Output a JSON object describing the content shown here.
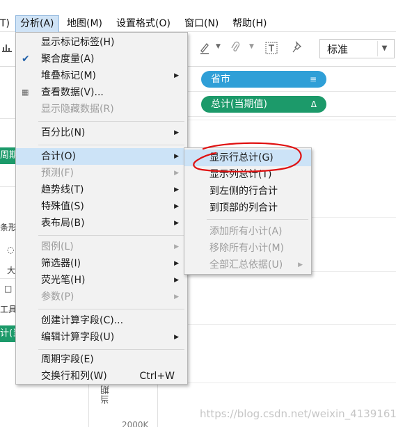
{
  "menubar": {
    "items": [
      {
        "label": "T)"
      },
      {
        "label": "分析(A)"
      },
      {
        "label": "地图(M)"
      },
      {
        "label": "设置格式(O)"
      },
      {
        "label": "窗口(N)"
      },
      {
        "label": "帮助(H)"
      }
    ]
  },
  "toolbar": {
    "standard_select": "标准"
  },
  "shelves": {
    "rows_pill": {
      "label": "省市",
      "icon": "≡",
      "color": "#2f9fd7"
    },
    "measure_pill": {
      "label": "总计(当期值)",
      "icon": "Δ",
      "color": "#1c9a6a"
    }
  },
  "left_strip": {
    "green1": "周期",
    "text1": "条形图",
    "text2": "大",
    "text3": "工具",
    "green2": "计(当"
  },
  "canvas": {
    "vertical_axis_label": "当期值 的",
    "bottom_number": "2000K"
  },
  "watermark": "https://blog.csdn.net/weixin_41391619",
  "analysis_menu": {
    "items": [
      {
        "label": "显示标记标签(H)",
        "disabled": false
      },
      {
        "label": "聚合度量(A)",
        "checked": true
      },
      {
        "label": "堆叠标记(M)",
        "submenu": true
      },
      {
        "label": "查看数据(V)..."
      },
      {
        "label": "显示隐藏数据(R)",
        "disabled": true
      },
      {
        "label": "百分比(N)",
        "submenu": true
      },
      {
        "label": "合计(O)",
        "submenu": true,
        "highlighted": true
      },
      {
        "label": "预测(F)",
        "submenu": true,
        "disabled": true
      },
      {
        "label": "趋势线(T)",
        "submenu": true
      },
      {
        "label": "特殊值(S)",
        "submenu": true
      },
      {
        "label": "表布局(B)",
        "submenu": true
      },
      {
        "label": "图例(L)",
        "submenu": true,
        "disabled": true
      },
      {
        "label": "筛选器(I)",
        "submenu": true
      },
      {
        "label": "荧光笔(H)",
        "submenu": true
      },
      {
        "label": "参数(P)",
        "submenu": true,
        "disabled": true
      },
      {
        "label": "创建计算字段(C)..."
      },
      {
        "label": "编辑计算字段(U)",
        "submenu": true
      },
      {
        "label": "周期字段(E)"
      },
      {
        "label": "交换行和列(W)",
        "shortcut": "Ctrl+W"
      }
    ]
  },
  "totals_submenu": {
    "items": [
      {
        "label": "显示行总计(G)",
        "circled": true
      },
      {
        "label": "显示列总计(T)"
      },
      {
        "label": "到左侧的行合计"
      },
      {
        "label": "到顶部的列合计"
      },
      {
        "label": "添加所有小计(A)",
        "disabled": true
      },
      {
        "label": "移除所有小计(M)",
        "disabled": true
      },
      {
        "label": "全部汇总依据(U)",
        "disabled": true,
        "submenu": true
      }
    ]
  },
  "colors": {
    "menu_bg": "#f2f2f2",
    "highlight": "#cce3f7",
    "annotation": "#e01010"
  }
}
